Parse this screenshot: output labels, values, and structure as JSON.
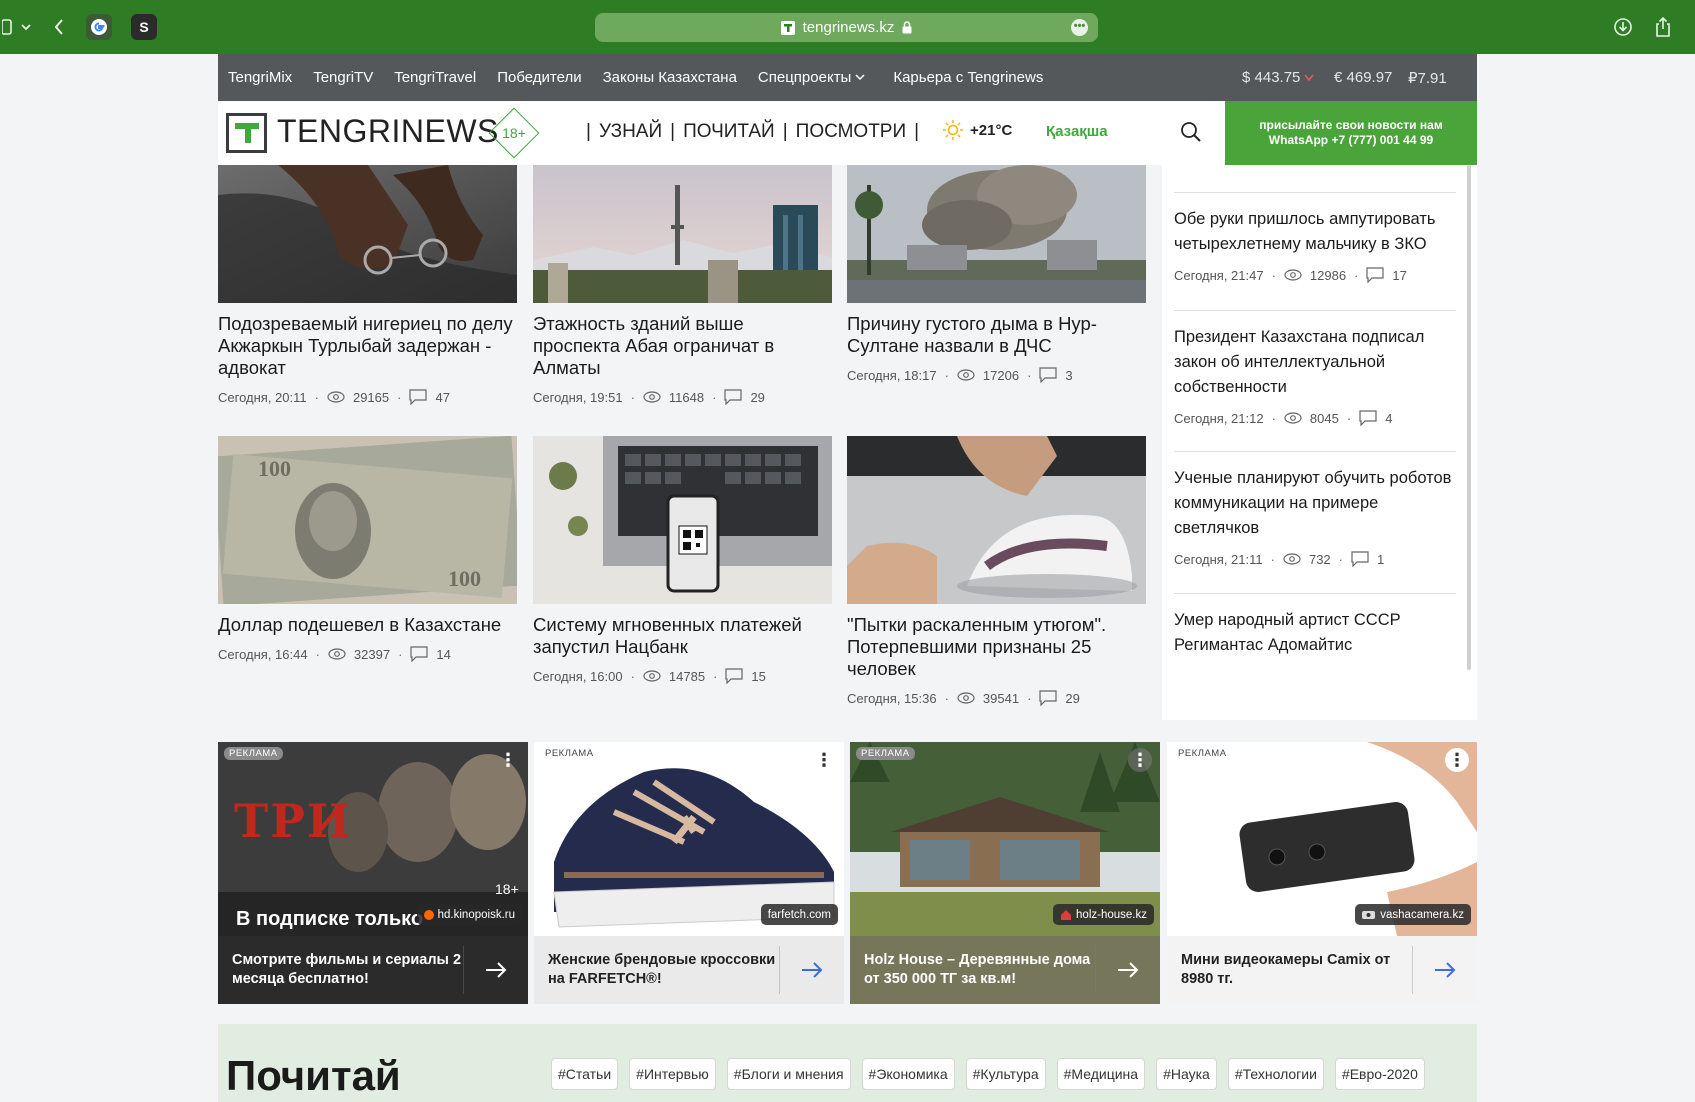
{
  "browser": {
    "url": "tengrinews.kz",
    "tab_icon_s": "S"
  },
  "topnav": {
    "items": [
      "TengriMix",
      "TengriTV",
      "TengriTravel",
      "Победители",
      "Законы Казахстана",
      "Спецпроекты",
      "Карьера с Tengrinews"
    ],
    "usd": "$ 443.75",
    "eur": "€ 469.97",
    "rub": "₽7.91"
  },
  "header": {
    "logo": "TENGRINEWS",
    "age": "18+",
    "sections": [
      "УЗНАЙ",
      "ПОЧИТАЙ",
      "ПОСМОТРИ"
    ],
    "separator": "|",
    "temperature": "+21°C",
    "language": "Қазақша",
    "whatsapp_line1": "присылайте свои новости нам",
    "whatsapp_line2": "WhatsApp +7 (777) 001 44 99"
  },
  "news": [
    {
      "title": "Подозреваемый нигериец по делу Акжаркын Турлыбай задержан - адвокат",
      "time": "Сегодня, 20:11",
      "views": "29165",
      "comments": "47"
    },
    {
      "title": "Этажность зданий выше проспекта Абая ограничат в Алматы",
      "time": "Сегодня, 19:51",
      "views": "11648",
      "comments": "29"
    },
    {
      "title": "Причину густого дыма в Нур-Султане назвали в ДЧС",
      "time": "Сегодня, 18:17",
      "views": "17206",
      "comments": "3"
    },
    {
      "title": "Доллар подешевел в Казахстане",
      "time": "Сегодня, 16:44",
      "views": "32397",
      "comments": "14"
    },
    {
      "title": "Систему мгновенных платежей запустил Нацбанк",
      "time": "Сегодня, 16:00",
      "views": "14785",
      "comments": "15"
    },
    {
      "title": "\"Пытки раскаленным утюгом\". Потерпевшими признаны 25 человек",
      "time": "Сегодня, 15:36",
      "views": "39541",
      "comments": "29"
    }
  ],
  "sidebar": [
    {
      "title": "Обе руки пришлось ампутировать четырехлетнему мальчику в ЗКО",
      "time": "Сегодня, 21:47",
      "views": "12986",
      "comments": "17"
    },
    {
      "title": "Президент Казахстана подписал закон об интеллектуальной собственности",
      "time": "Сегодня, 21:12",
      "views": "8045",
      "comments": "4"
    },
    {
      "title": "Ученые планируют обучить роботов коммуникации на примере светлячков",
      "time": "Сегодня, 21:11",
      "views": "732",
      "comments": "1"
    },
    {
      "title": "Умер народный артист СССР Регимантас Адомайтис",
      "time": "",
      "views": "",
      "comments": ""
    }
  ],
  "ads": [
    {
      "label": "РЕКЛАМА",
      "domain": "hd.kinopoisk.ru",
      "text": "Смотрите фильмы и сериалы 2 месяца бесплатно!",
      "poster_title": "ТРИ",
      "poster_sub": "В подписке только",
      "age": "18+"
    },
    {
      "label": "РЕКЛАМА",
      "domain": "farfetch.com",
      "text": "Женские брендовые кроссовки на FARFETCH®!"
    },
    {
      "label": "РЕКЛАМА",
      "domain": "holz-house.kz",
      "text": "Holz House – Деревянные дома от 350 000 ТГ за кв.м!"
    },
    {
      "label": "РЕКЛАМА",
      "domain": "vashacamera.kz",
      "text": "Мини видеокамеры Camix от 8980 тг."
    }
  ],
  "read": {
    "title": "Почитай",
    "tags": [
      "#Статьи",
      "#Интервью",
      "#Блоги и мнения",
      "#Экономика",
      "#Культура",
      "#Медицина",
      "#Наука",
      "#Технологии",
      "#Евро-2020"
    ]
  },
  "colors": {
    "browser_green": "#2e7d24",
    "brand_green": "#4aa43a",
    "nav_gray": "#55585b"
  }
}
